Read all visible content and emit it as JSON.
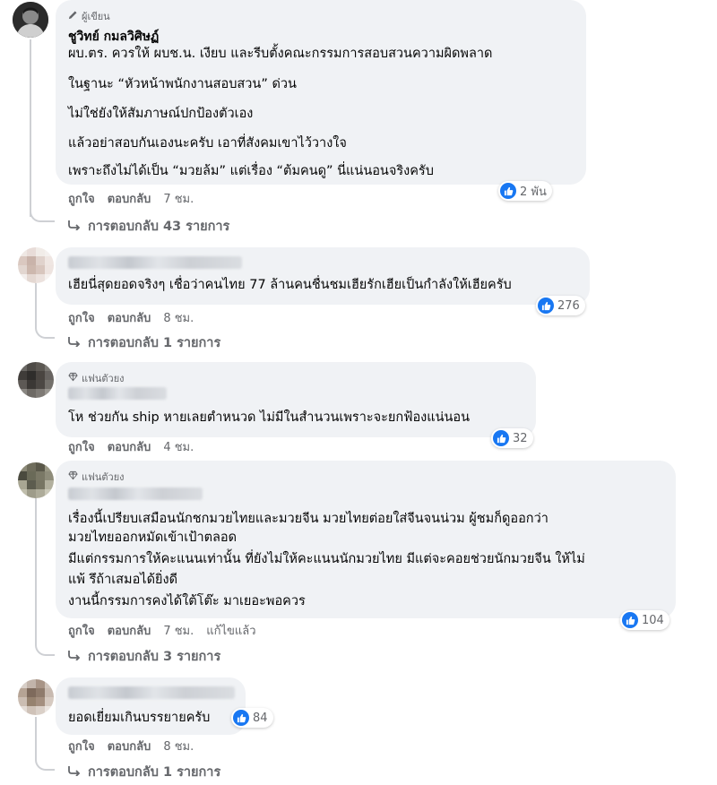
{
  "comments": [
    {
      "badge": "ผู้เขียน",
      "author": "ชูวิทย์ กมลวิศิษฏ์",
      "lines": [
        "ผบ.ตร. ควรให้ ผบช.น. เงียบ และรีบตั้งคณะกรรมการสอบสวนความผิดพลาด",
        "ในฐานะ “หัวหน้าพนักงานสอบสวน” ด่วน",
        "ไม่ใช่ยังให้สัมภาษณ์ปกป้องตัวเอง",
        "แล้วอย่าสอบกันเองนะครับ เอาที่สังคมเขาไว้วางใจ",
        "เพราะถึงไม่ได้เป็น “มวยล้ม” แต่เรื่อง “ต้มคนดู” นี่แน่นอนจริงครับ"
      ],
      "like": "ถูกใจ",
      "reply": "ตอบกลับ",
      "time": "7 ชม.",
      "reactions": "2 พัน",
      "replies": "การตอบกลับ 43 รายการ",
      "icon": "pencil-icon"
    },
    {
      "lines": [
        "เฮียนี่สุดยอดจริงๆ เชื่อว่าคนไทย 77 ล้านคนชื่นชมเฮียรักเฮียเป็นกำลังให้เฮียครับ"
      ],
      "like": "ถูกใจ",
      "reply": "ตอบกลับ",
      "time": "8 ชม.",
      "reactions": "276",
      "replies": "การตอบกลับ 1 รายการ"
    },
    {
      "badge": "แฟนตัวยง",
      "lines": [
        "โห ช่วยกัน ship หายเลยตำหนวด ไม่มีในสำนวนเพราะจะยกฟ้องแน่นอน"
      ],
      "like": "ถูกใจ",
      "reply": "ตอบกลับ",
      "time": "4 ชม.",
      "reactions": "32",
      "icon": "diamond-icon"
    },
    {
      "badge": "แฟนตัวยง",
      "lines": [
        "เรื่องนี้เปรียบเสมือนนักชกมวยไทยและมวยจีน มวยไทยต่อยใส่จีนจนน่วม ผู้ชมก็ดูออกว่า",
        "มวยไทยออกหมัดเข้าเป้าตลอด",
        "มีแต่กรรมการให้คะแนนเท่านั้น ที่ยังไม่ให้คะแนนนักมวยไทย มีแต่จะคอยช่วยนักมวยจีน ให้ไม่",
        "แพ้ รึถ้าเสมอได้ยิ่งดี",
        "งานนี้กรรมการคงได้ใต้โต๊ะ มาเยอะพอควร"
      ],
      "like": "ถูกใจ",
      "reply": "ตอบกลับ",
      "time": "7 ชม.",
      "edited": "แก้ไขแล้ว",
      "reactions": "104",
      "replies": "การตอบกลับ 3 รายการ",
      "icon": "diamond-icon"
    },
    {
      "lines": [
        "ยอดเยี่ยมเกินบรรยายครับ"
      ],
      "like": "ถูกใจ",
      "reply": "ตอบกลับ",
      "time": "8 ชม.",
      "reactions": "84",
      "replies": "การตอบกลับ 1 รายการ"
    }
  ],
  "colors": {
    "bubble": "#f0f2f5",
    "secondary_text": "#65676b",
    "like_blue": "#1877f2",
    "thread_line": "#ced0d4"
  }
}
